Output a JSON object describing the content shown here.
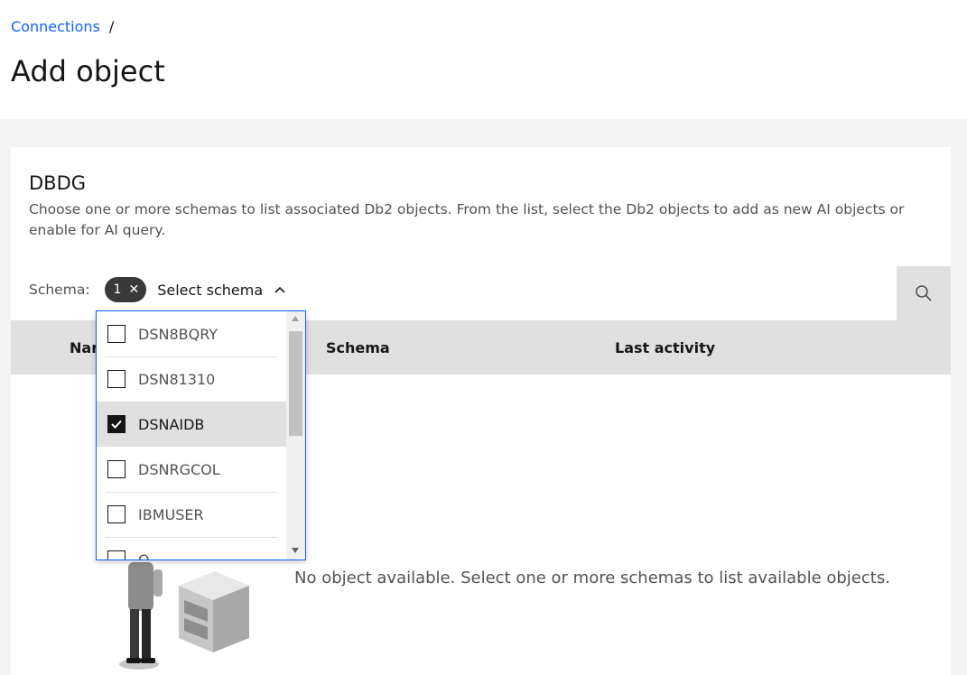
{
  "breadcrumb": {
    "link": "Connections",
    "separator": "/"
  },
  "page": {
    "title": "Add object"
  },
  "card": {
    "title": "DBDG",
    "description": "Choose one or more schemas to list associated Db2 objects. From the list, select the Db2 objects to add as new AI objects or enable for AI query."
  },
  "schema_filter": {
    "label": "Schema:",
    "selected_count": "1",
    "clear_glyph": "✕",
    "placeholder": "Select schema",
    "state": "open"
  },
  "search": {
    "icon": "search-icon"
  },
  "table": {
    "columns": [
      "Name",
      "Schema",
      "Last activity"
    ],
    "name_visible": "Nar"
  },
  "dropdown": {
    "items": [
      {
        "label": "DSN8BQRY",
        "checked": false
      },
      {
        "label": "DSN81310",
        "checked": false
      },
      {
        "label": "DSNAIDB",
        "checked": true
      },
      {
        "label": "DSNRGCOL",
        "checked": false
      },
      {
        "label": "IBMUSER",
        "checked": false
      },
      {
        "label": "Q",
        "checked": false
      }
    ]
  },
  "empty_state": {
    "message": "No object available. Select one or more schemas to list available objects."
  },
  "colors": {
    "link": "#0f62fe",
    "tag_bg": "#393939",
    "header_bg": "#e0e0e0",
    "page_bg": "#f4f4f4"
  }
}
